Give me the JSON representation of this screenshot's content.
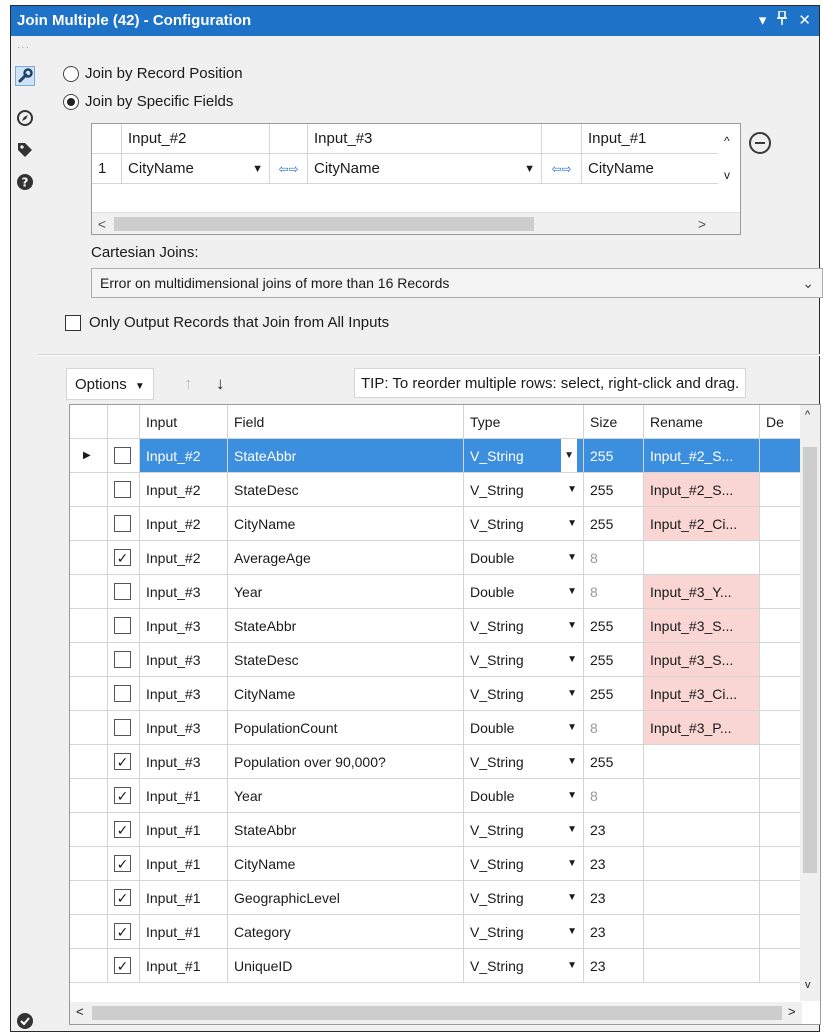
{
  "window": {
    "title": "Join Multiple (42) - Configuration",
    "controls": [
      "▾",
      "⊓",
      "✕"
    ]
  },
  "sidebar": {
    "icons": [
      "wrench-icon",
      "compass-icon",
      "tag-icon",
      "help-icon",
      "check-circle-icon"
    ]
  },
  "join_mode": {
    "option_position": "Join by Record Position",
    "option_fields": "Join by Specific Fields",
    "selected": "Join by Specific Fields"
  },
  "join_grid": {
    "headers": [
      "Input_#2",
      "Input_#3",
      "Input_#1"
    ],
    "row_number": "1",
    "row_values": [
      "CityName",
      "CityName",
      "CityName"
    ],
    "scroll_left": "<",
    "scroll_right": ">",
    "scroll_up": "^",
    "scroll_down": "v"
  },
  "cartesian": {
    "label": "Cartesian Joins:",
    "value": "Error on multidimensional joins of more than 16 Records"
  },
  "only_output": {
    "label": "Only Output Records that Join from All Inputs",
    "checked": false
  },
  "toolbar": {
    "options_label": "Options",
    "tip": "TIP: To reorder multiple rows: select, right-click and drag."
  },
  "fields_grid": {
    "headers": [
      "Input",
      "Field",
      "Type",
      "Size",
      "Rename",
      "De"
    ],
    "rows": [
      {
        "checked": false,
        "input": "Input_#2",
        "field": "StateAbbr",
        "type": "V_String",
        "size": "255",
        "rename": "Input_#2_S...",
        "selected": true
      },
      {
        "checked": false,
        "input": "Input_#2",
        "field": "StateDesc",
        "type": "V_String",
        "size": "255",
        "rename": "Input_#2_S..."
      },
      {
        "checked": false,
        "input": "Input_#2",
        "field": "CityName",
        "type": "V_String",
        "size": "255",
        "rename": "Input_#2_Ci..."
      },
      {
        "checked": true,
        "input": "Input_#2",
        "field": "AverageAge",
        "type": "Double",
        "size": "8",
        "rename": ""
      },
      {
        "checked": false,
        "input": "Input_#3",
        "field": "Year",
        "type": "Double",
        "size": "8",
        "rename": "Input_#3_Y..."
      },
      {
        "checked": false,
        "input": "Input_#3",
        "field": "StateAbbr",
        "type": "V_String",
        "size": "255",
        "rename": "Input_#3_S..."
      },
      {
        "checked": false,
        "input": "Input_#3",
        "field": "StateDesc",
        "type": "V_String",
        "size": "255",
        "rename": "Input_#3_S..."
      },
      {
        "checked": false,
        "input": "Input_#3",
        "field": "CityName",
        "type": "V_String",
        "size": "255",
        "rename": "Input_#3_Ci..."
      },
      {
        "checked": false,
        "input": "Input_#3",
        "field": "PopulationCount",
        "type": "Double",
        "size": "8",
        "rename": "Input_#3_P..."
      },
      {
        "checked": true,
        "input": "Input_#3",
        "field": "Population over 90,000?",
        "type": "V_String",
        "size": "255",
        "rename": ""
      },
      {
        "checked": true,
        "input": "Input_#1",
        "field": "Year",
        "type": "Double",
        "size": "8",
        "rename": ""
      },
      {
        "checked": true,
        "input": "Input_#1",
        "field": "StateAbbr",
        "type": "V_String",
        "size": "23",
        "rename": ""
      },
      {
        "checked": true,
        "input": "Input_#1",
        "field": "CityName",
        "type": "V_String",
        "size": "23",
        "rename": ""
      },
      {
        "checked": true,
        "input": "Input_#1",
        "field": "GeographicLevel",
        "type": "V_String",
        "size": "23",
        "rename": ""
      },
      {
        "checked": true,
        "input": "Input_#1",
        "field": "Category",
        "type": "V_String",
        "size": "23",
        "rename": ""
      },
      {
        "checked": true,
        "input": "Input_#1",
        "field": "UniqueID",
        "type": "V_String",
        "size": "23",
        "rename": ""
      }
    ]
  },
  "colors": {
    "title_bar": "#1e72c8",
    "selection": "#3c8ede",
    "rename_highlight": "#f9d6d4",
    "arrow_blue": "#2d6fd3",
    "status_ok": "#2b2b2b"
  }
}
